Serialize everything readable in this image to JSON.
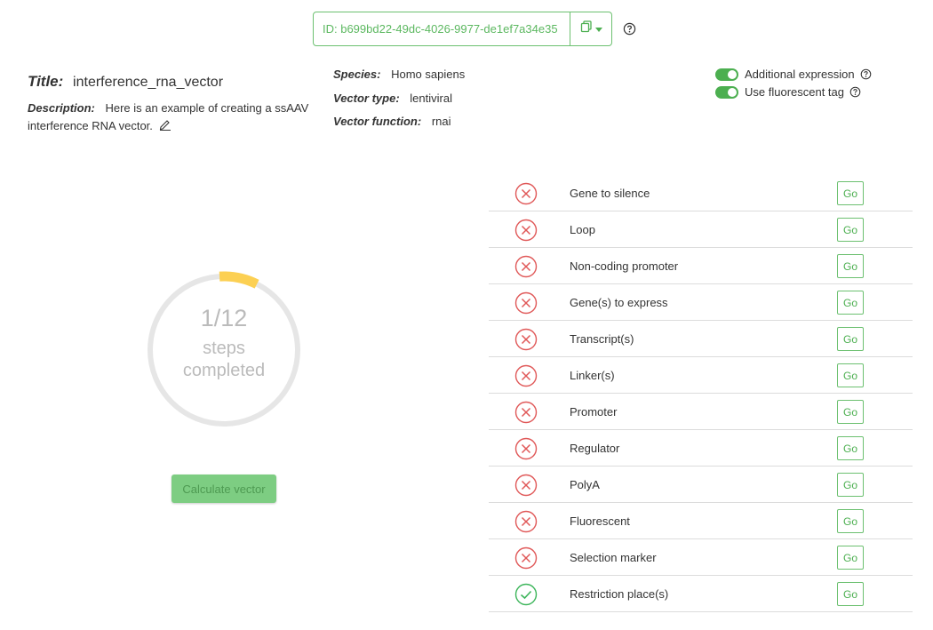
{
  "header": {
    "id_text": "ID: b699bd22-49dc-4026-9977-de1ef7a34e35"
  },
  "info": {
    "title_label": "Title:",
    "title_value": "interference_rna_vector",
    "description_label": "Description:",
    "description_value": "Here is an example of creating a ssAAV interference RNA vector.",
    "species_label": "Species:",
    "species_value": "Homo sapiens",
    "vector_type_label": "Vector type:",
    "vector_type_value": "lentiviral",
    "vector_function_label": "Vector function:",
    "vector_function_value": "rnai"
  },
  "toggles": [
    {
      "label": "Additional expression",
      "on": true
    },
    {
      "label": "Use fluorescent tag",
      "on": true
    }
  ],
  "progress": {
    "count": "1/12",
    "label_line1": "steps",
    "label_line2": "completed",
    "fraction": 0.0833
  },
  "calculate_label": "Calculate vector",
  "colors": {
    "accent": "#4caf50",
    "error": "#e05858",
    "progress": "#fcd053",
    "track": "#e6e6e6"
  },
  "steps": [
    {
      "name": "Gene to silence",
      "status": "error",
      "go": "Go"
    },
    {
      "name": "Loop",
      "status": "error",
      "go": "Go"
    },
    {
      "name": "Non-coding promoter",
      "status": "error",
      "go": "Go"
    },
    {
      "name": "Gene(s) to express",
      "status": "error",
      "go": "Go"
    },
    {
      "name": "Transcript(s)",
      "status": "error",
      "go": "Go"
    },
    {
      "name": "Linker(s)",
      "status": "error",
      "go": "Go"
    },
    {
      "name": "Promoter",
      "status": "error",
      "go": "Go"
    },
    {
      "name": "Regulator",
      "status": "error",
      "go": "Go"
    },
    {
      "name": "PolyA",
      "status": "error",
      "go": "Go"
    },
    {
      "name": "Fluorescent",
      "status": "error",
      "go": "Go"
    },
    {
      "name": "Selection marker",
      "status": "error",
      "go": "Go"
    },
    {
      "name": "Restriction place(s)",
      "status": "done",
      "go": "Go"
    }
  ]
}
